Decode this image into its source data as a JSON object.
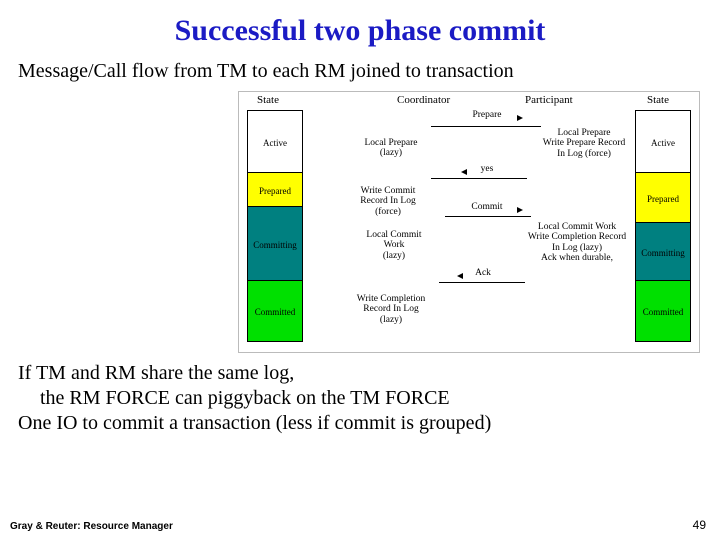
{
  "title": "Successful two phase commit",
  "subtitle": "Message/Call flow from TM to each RM joined to transaction",
  "body": {
    "line1": "If TM and RM share the same log,",
    "line2": "the RM  FORCE can piggyback on the TM  FORCE",
    "line3": "One IO to commit a transaction (less if commit is grouped)"
  },
  "footer": {
    "left": "Gray & Reuter: Resource Manager",
    "right": "49"
  },
  "fig": {
    "headers": {
      "stateL": "State",
      "coord": "Coordinator",
      "part": "Participant",
      "stateR": "State"
    },
    "statesL": [
      "Active",
      "Prepared",
      "Committing",
      "Committed"
    ],
    "statesR": [
      "Active",
      "Prepared",
      "Committing",
      "Committed"
    ],
    "msgs": {
      "prepare": "Prepare",
      "yes": "yes",
      "commit": "Commit",
      "ack": "Ack"
    },
    "notes": {
      "localPrepLazy": "Local Prepare\n(lazy)",
      "partPrepare": "Local Prepare\nWrite Prepare Record\nIn Log (force)",
      "writeCommitForce": "Write Commit\nRecord In Log\n(force)",
      "localCommitLazy": "Local Commit\nWork\n(lazy)",
      "partCommit": "Local Commit Work\nWrite Completion Record\nIn Log (lazy)\nAck when  durable,",
      "writeCompletion": "Write Completion\nRecord In Log\n(lazy)"
    }
  }
}
